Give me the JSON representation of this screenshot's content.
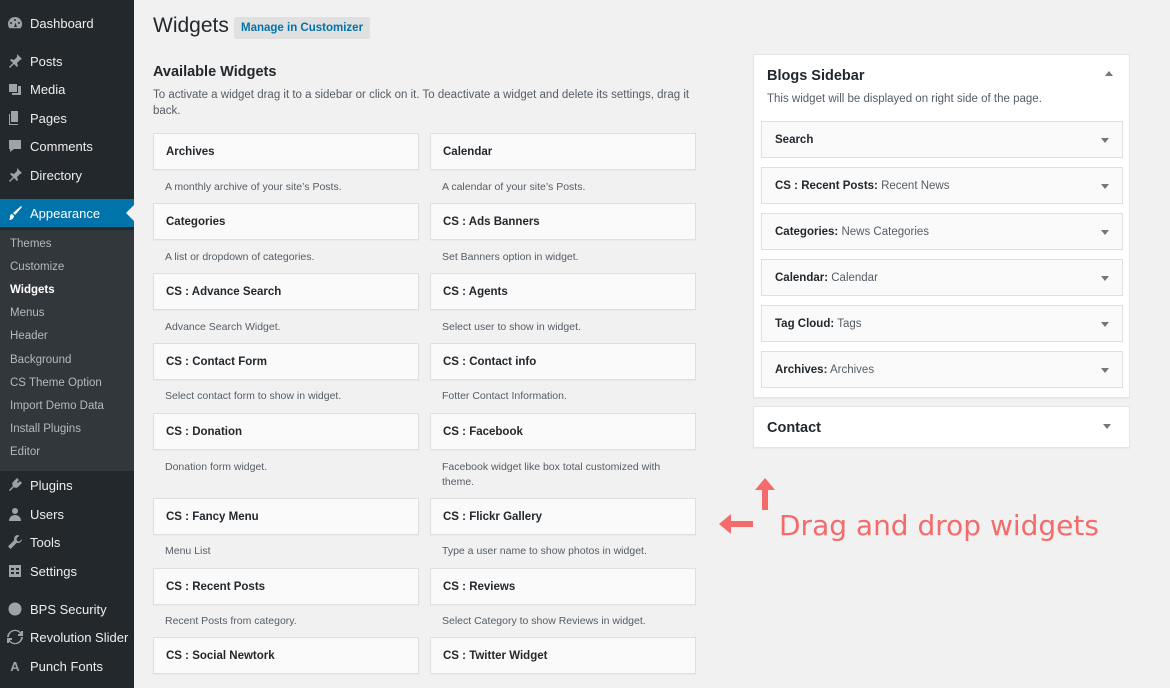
{
  "sidebar": {
    "items": [
      {
        "label": "Dashboard",
        "icon": "dashboard-icon"
      },
      {
        "label": "Posts",
        "icon": "pin-icon"
      },
      {
        "label": "Media",
        "icon": "media-icon"
      },
      {
        "label": "Pages",
        "icon": "pages-icon"
      },
      {
        "label": "Comments",
        "icon": "comments-icon"
      },
      {
        "label": "Directory",
        "icon": "pin-icon"
      },
      {
        "label": "Appearance",
        "icon": "brush-icon"
      },
      {
        "label": "Plugins",
        "icon": "plugin-icon"
      },
      {
        "label": "Users",
        "icon": "users-icon"
      },
      {
        "label": "Tools",
        "icon": "wrench-icon"
      },
      {
        "label": "Settings",
        "icon": "settings-icon"
      },
      {
        "label": "BPS Security",
        "icon": "shield-icon"
      },
      {
        "label": "Revolution Slider",
        "icon": "refresh-icon"
      },
      {
        "label": "Punch Fonts",
        "icon": "font-icon"
      }
    ],
    "submenu": [
      "Themes",
      "Customize",
      "Widgets",
      "Menus",
      "Header",
      "Background",
      "CS Theme Option",
      "Import Demo Data",
      "Install Plugins",
      "Editor"
    ],
    "colors": {
      "bg": "#23282d",
      "active": "#0073aa",
      "submenu_bg": "#32373c"
    }
  },
  "page": {
    "title": "Widgets",
    "customizer_button": "Manage in Customizer"
  },
  "available": {
    "title": "Available Widgets",
    "description": "To activate a widget drag it to a sidebar or click on it. To deactivate a widget and delete its settings, drag it back.",
    "widgets": [
      {
        "title": "Archives",
        "desc": "A monthly archive of your site’s Posts."
      },
      {
        "title": "Calendar",
        "desc": "A calendar of your site’s Posts."
      },
      {
        "title": "Categories",
        "desc": "A list or dropdown of categories."
      },
      {
        "title": "CS : Ads Banners",
        "desc": "Set Banners option in widget."
      },
      {
        "title": "CS : Advance Search",
        "desc": "Advance Search Widget."
      },
      {
        "title": "CS : Agents",
        "desc": "Select user to show in widget."
      },
      {
        "title": "CS : Contact Form",
        "desc": "Select contact form to show in widget."
      },
      {
        "title": "CS : Contact info",
        "desc": "Fotter Contact Information."
      },
      {
        "title": "CS : Donation",
        "desc": "Donation form widget."
      },
      {
        "title": "CS : Facebook",
        "desc": "Facebook widget like box total customized with theme."
      },
      {
        "title": "CS : Fancy Menu",
        "desc": "Menu List"
      },
      {
        "title": "CS : Flickr Gallery",
        "desc": "Type a user name to show photos in widget."
      },
      {
        "title": "CS : Recent Posts",
        "desc": "Recent Posts from category."
      },
      {
        "title": "CS : Reviews",
        "desc": "Select Category to show Reviews in widget."
      },
      {
        "title": "CS : Social Newtork",
        "desc": ""
      },
      {
        "title": "CS : Twitter Widget",
        "desc": ""
      }
    ]
  },
  "blogs_sidebar": {
    "title": "Blogs Sidebar",
    "description": "This widget will be displayed on right side of the page.",
    "widgets": [
      {
        "title": "Search",
        "sub": ""
      },
      {
        "title": "CS : Recent Posts:",
        "sub": " Recent News"
      },
      {
        "title": "Categories:",
        "sub": " News Categories"
      },
      {
        "title": "Calendar:",
        "sub": " Calendar"
      },
      {
        "title": "Tag Cloud:",
        "sub": " Tags"
      },
      {
        "title": "Archives:",
        "sub": " Archives"
      }
    ]
  },
  "contact_sidebar": {
    "title": "Contact"
  },
  "annotation": {
    "text": "Drag and drop widgets",
    "color": "#f56b6b"
  }
}
